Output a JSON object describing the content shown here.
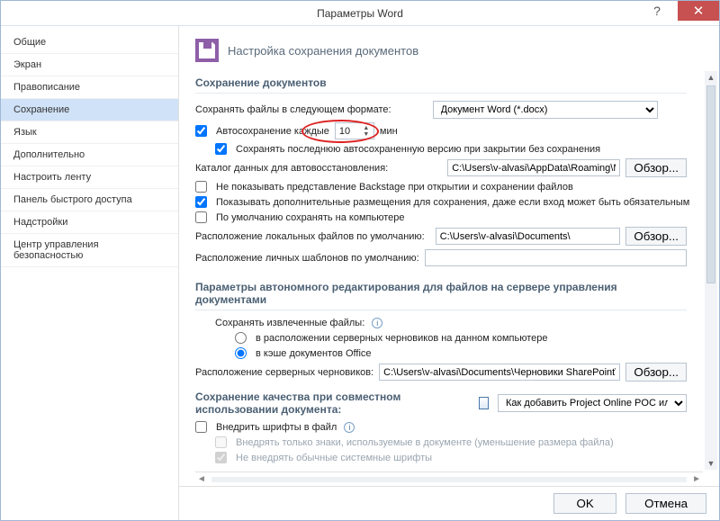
{
  "window": {
    "title": "Параметры Word"
  },
  "sidebar": {
    "items": [
      "Общие",
      "Экран",
      "Правописание",
      "Сохранение",
      "Язык",
      "Дополнительно",
      "Настроить ленту",
      "Панель быстрого доступа",
      "Надстройки",
      "Центр управления безопасностью"
    ],
    "selected_index": 3
  },
  "header": {
    "title": "Настройка сохранения документов"
  },
  "sec1": {
    "title": "Сохранение документов",
    "format_label": "Сохранять файлы в следующем формате:",
    "format_value": "Документ Word (*.docx)",
    "autosave_label": "Автосохранение каждые",
    "autosave_value": "10",
    "autosave_unit": "мин",
    "keep_last_label": "Сохранять последнюю автосохраненную версию при закрытии без сохранения",
    "recovery_dir_label": "Каталог данных для автовосстановления:",
    "recovery_dir_value": "C:\\Users\\v-alvasi\\AppData\\Roaming\\Microsoft\\Word",
    "browse": "Обзор...",
    "no_backstage_label": "Не показывать представление Backstage при открытии и сохранении файлов",
    "show_additional_label": "Показывать дополнительные размещения для сохранения, даже если вход может быть обязательным",
    "save_local_default_label": "По умолчанию сохранять на компьютере",
    "local_files_label": "Расположение локальных файлов по умолчанию:",
    "local_files_value": "C:\\Users\\v-alvasi\\Documents\\",
    "personal_templates_label": "Расположение личных шаблонов по умолчанию:",
    "personal_templates_value": ""
  },
  "sec2": {
    "title": "Параметры автономного редактирования для файлов на сервере управления документами",
    "save_checked_label": "Сохранять извлеченные файлы:",
    "radio1": "в расположении серверных черновиков на данном компьютере",
    "radio2": "в кэше документов Office",
    "server_drafts_label": "Расположение серверных черновиков:",
    "server_drafts_value": "C:\\Users\\v-alvasi\\Documents\\Черновики SharePoint\\",
    "browse": "Обзор..."
  },
  "sec3": {
    "title": "Сохранение качества при совместном использовании документа:",
    "doc_value": "Как добавить Project Online POC или D...",
    "embed_fonts_label": "Внедрить шрифты в файл",
    "embed_used_label": "Внедрять только знаки, используемые в документе (уменьшение размера файла)",
    "no_embed_sys_label": "Не внедрять обычные системные шрифты"
  },
  "footer": {
    "ok": "OK",
    "cancel": "Отмена"
  }
}
